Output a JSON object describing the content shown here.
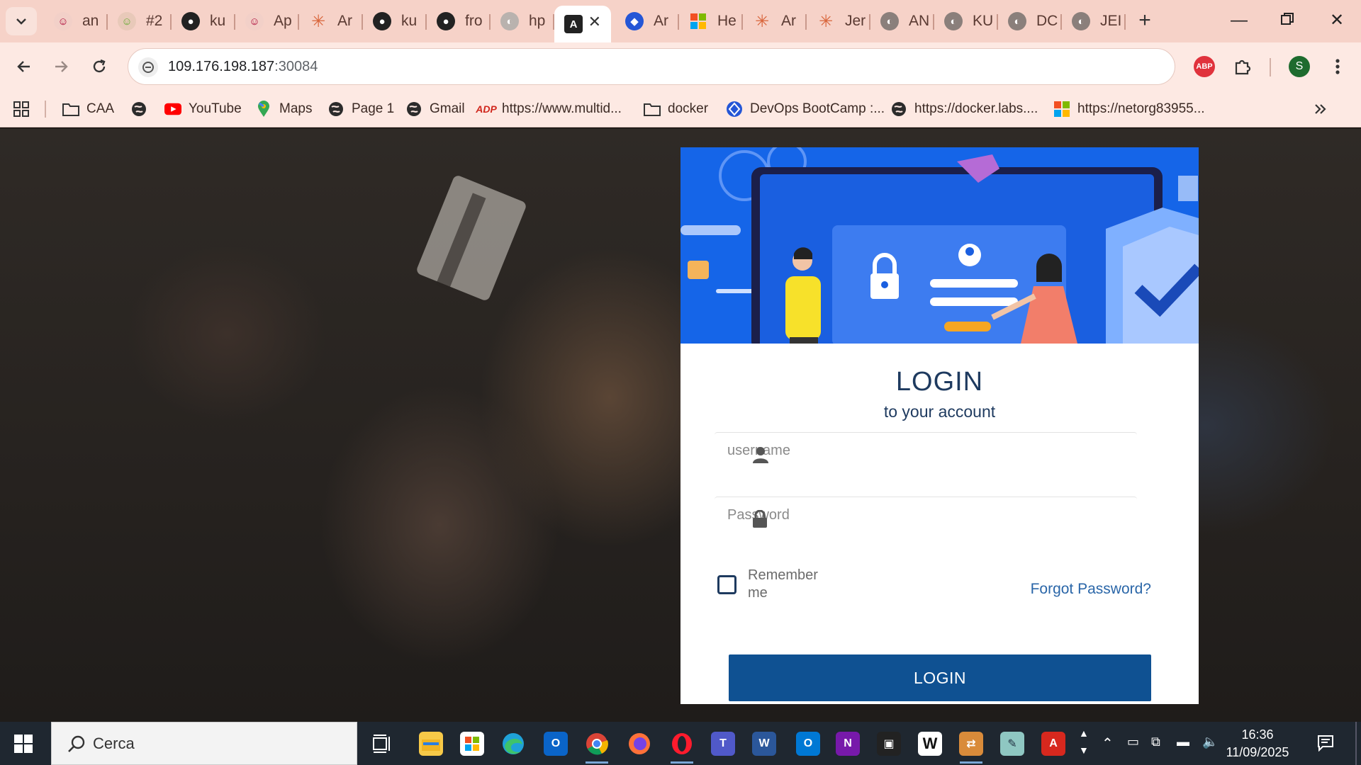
{
  "browser": {
    "tabs": [
      {
        "label": "an",
        "icon": "avatar-icon"
      },
      {
        "label": "#2",
        "icon": "avatar-icon"
      },
      {
        "label": "ku",
        "icon": "github-icon"
      },
      {
        "label": "Ap",
        "icon": "avatar-icon"
      },
      {
        "label": "Ar",
        "icon": "claude-icon"
      },
      {
        "label": "ku",
        "icon": "github-icon"
      },
      {
        "label": "fro",
        "icon": "github-icon"
      },
      {
        "label": "hp",
        "icon": "globe-icon"
      },
      {
        "label": "",
        "icon": "angular-icon",
        "active": true
      },
      {
        "label": "Ar",
        "icon": "devops-icon"
      },
      {
        "label": "He",
        "icon": "office-icon"
      },
      {
        "label": "Ar",
        "icon": "claude-icon"
      },
      {
        "label": "Jer",
        "icon": "claude-icon"
      },
      {
        "label": "AN",
        "icon": "globe-icon"
      },
      {
        "label": "KU",
        "icon": "globe-icon"
      },
      {
        "label": "DC",
        "icon": "globe-icon"
      },
      {
        "label": "JEI",
        "icon": "globe-icon"
      }
    ],
    "url_host": "109.176.198.187",
    "url_port": ":30084",
    "profile_initial": "S",
    "abp_label": "ABP"
  },
  "bookmarks": [
    {
      "label": "",
      "icon": "apps-grid-icon"
    },
    {
      "label": "CAA",
      "icon": "folder-icon"
    },
    {
      "label": "",
      "icon": "globe-icon"
    },
    {
      "label": "YouTube",
      "icon": "youtube-icon"
    },
    {
      "label": "Maps",
      "icon": "maps-icon"
    },
    {
      "label": "Page 1",
      "icon": "globe-icon"
    },
    {
      "label": "Gmail",
      "icon": "globe-icon"
    },
    {
      "label": "https://www.multid...",
      "icon": "adp-icon"
    },
    {
      "label": "docker",
      "icon": "folder-icon"
    },
    {
      "label": "DevOps BootCamp :...",
      "icon": "devops-icon"
    },
    {
      "label": "https://docker.labs....",
      "icon": "globe-icon"
    },
    {
      "label": "https://netorg83955...",
      "icon": "microsoft-icon"
    }
  ],
  "login": {
    "title": "LOGIN",
    "subtitle": "to your account",
    "username_placeholder": "username",
    "password_placeholder": "Password",
    "remember_label": "Remember me",
    "forgot_label": "Forgot Password?",
    "button_label": "LOGIN"
  },
  "taskbar": {
    "search_label": "Cerca",
    "time": "16:36",
    "date": "11/09/2025"
  },
  "colors": {
    "tabstrip": "#f6d2c8",
    "hero_blue": "#1565e8",
    "login_button": "#0f5192",
    "title_text": "#1e3a5f"
  }
}
